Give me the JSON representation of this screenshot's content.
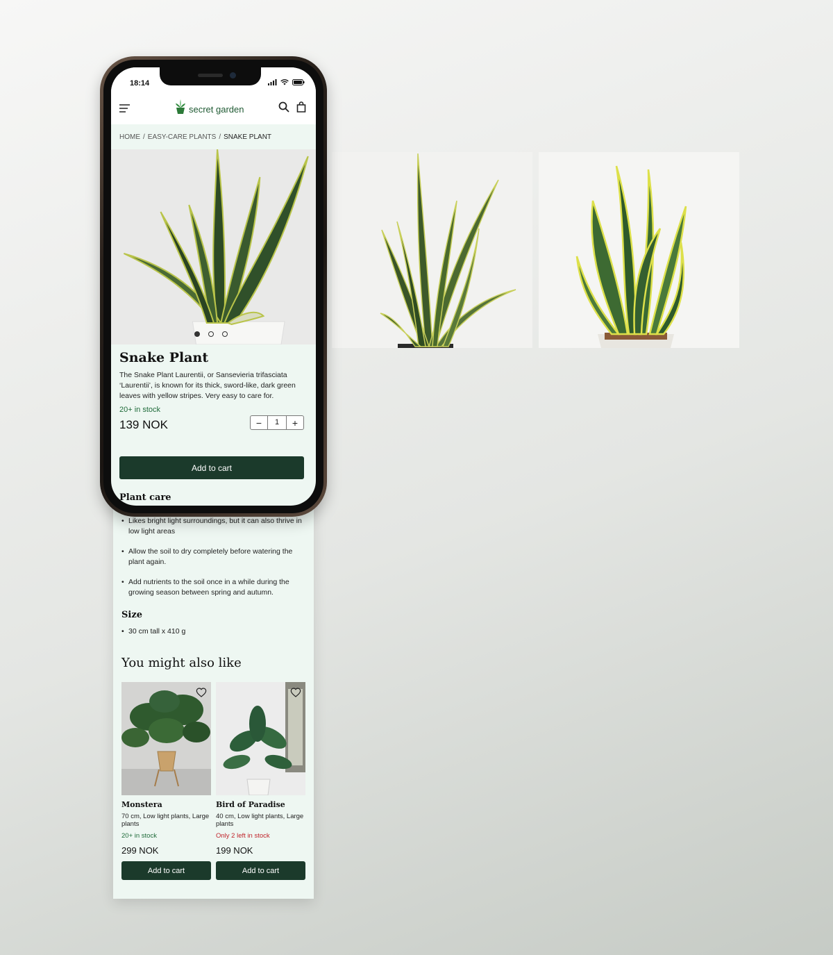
{
  "status_bar": {
    "time": "18:14"
  },
  "header": {
    "brand": "secret garden"
  },
  "breadcrumb": {
    "home": "HOME",
    "sep1": "/",
    "category": "EASY-CARE PLANTS",
    "sep2": "/",
    "current": "SNAKE PLANT"
  },
  "product": {
    "title": "Snake Plant",
    "description": "The Snake Plant Laurentii, or Sansevieria trifasciata ‘Laurentii’, is known for its thick, sword-like, dark green leaves with yellow stripes. Very easy to care for.",
    "stock": "20+ in stock",
    "price": "139 NOK",
    "quantity": "1",
    "minus": "−",
    "plus": "+",
    "add_to_cart": "Add to cart",
    "carousel_active": 1,
    "carousel_count": 3
  },
  "plant_care": {
    "title": "Plant care",
    "items": [
      "Likes bright light surroundings, but it can also thrive in low light areas",
      "Allow the soil to dry completely before watering the plant again.",
      "Add nutrients to the soil once in a while during the growing season between spring and autumn."
    ]
  },
  "size": {
    "title": "Size",
    "value": "30 cm tall  x  410 g"
  },
  "also_like": {
    "title": "You might also like",
    "cards": [
      {
        "name": "Monstera",
        "meta": "70 cm, Low light plants, Large plants",
        "stock": "20+ in stock",
        "price": "299 NOK",
        "button": "Add to cart"
      },
      {
        "name": "Bird of Paradise",
        "meta": "40 cm, Low light plants, Large plants",
        "stock": "Only 2 left in stock",
        "price": "199 NOK",
        "button": "Add to cart"
      }
    ]
  },
  "colors": {
    "brand_green": "#1b3a2b",
    "stock_green": "#1f6b3a",
    "stock_low": "#c0242b",
    "page_bg": "#eef7f2"
  }
}
